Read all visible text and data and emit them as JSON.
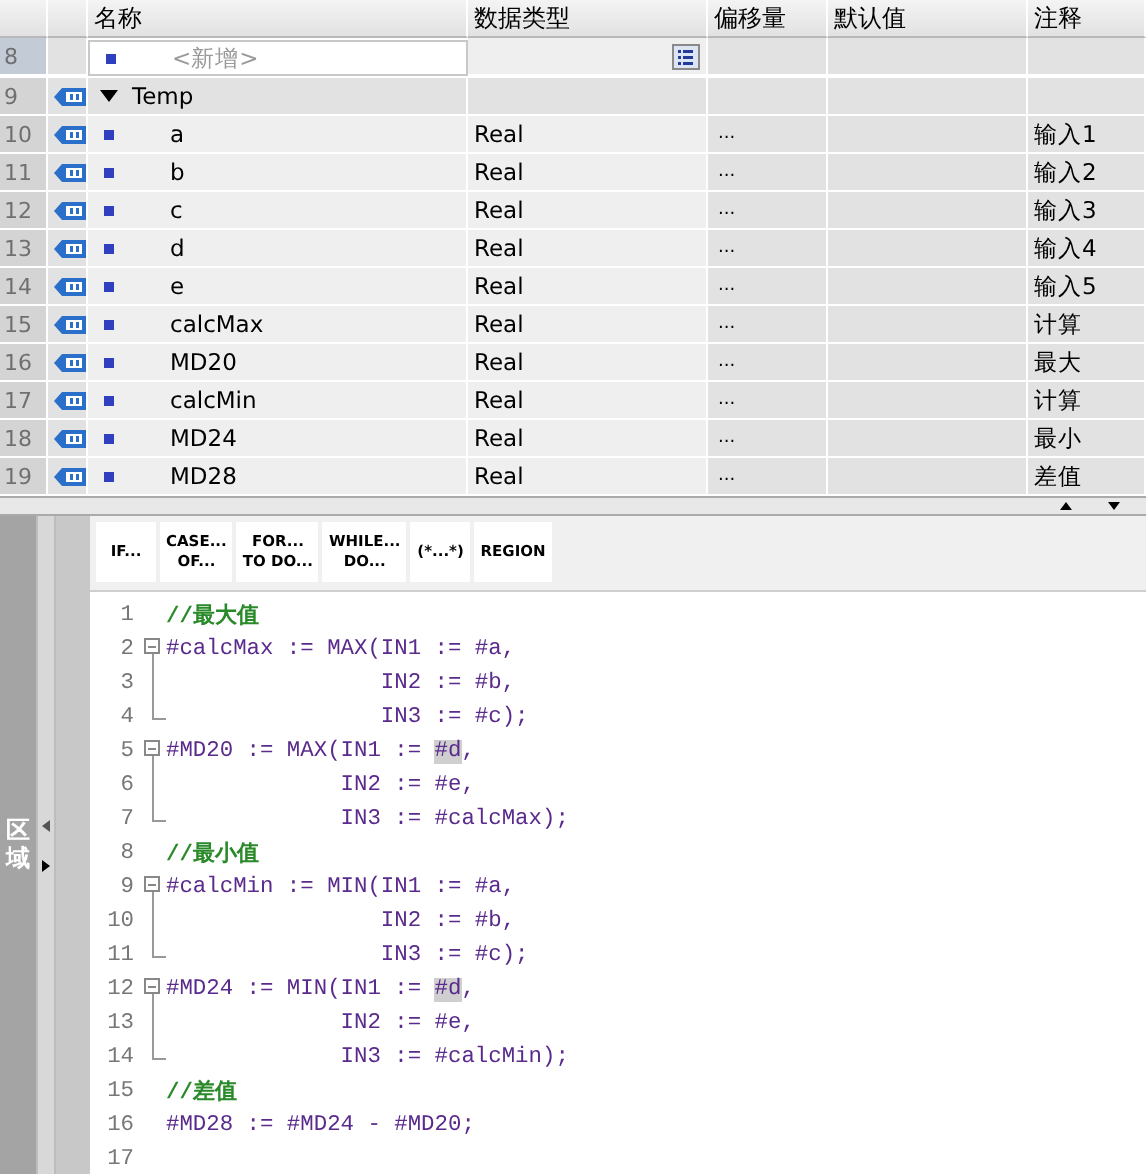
{
  "table": {
    "columns": [
      "名称",
      "数据类型",
      "偏移量",
      "默认值",
      "注释"
    ],
    "rows": [
      {
        "kind": "add",
        "number": "8",
        "selected": true,
        "placeholder": "<新增>"
      },
      {
        "kind": "section",
        "number": "9",
        "selected": false,
        "expanded": true,
        "name": "Temp"
      },
      {
        "kind": "var",
        "number": "10",
        "selected": false,
        "name": "a",
        "type": "Real",
        "offset": "...",
        "comment": "输入1"
      },
      {
        "kind": "var",
        "number": "11",
        "selected": false,
        "name": "b",
        "type": "Real",
        "offset": "...",
        "comment": "输入2"
      },
      {
        "kind": "var",
        "number": "12",
        "selected": false,
        "name": "c",
        "type": "Real",
        "offset": "...",
        "comment": "输入3"
      },
      {
        "kind": "var",
        "number": "13",
        "selected": false,
        "name": "d",
        "type": "Real",
        "offset": "...",
        "comment": "输入4"
      },
      {
        "kind": "var",
        "number": "14",
        "selected": false,
        "name": "e",
        "type": "Real",
        "offset": "...",
        "comment": "输入5"
      },
      {
        "kind": "var",
        "number": "15",
        "selected": false,
        "name": "calcMax",
        "type": "Real",
        "offset": "...",
        "comment": "计算"
      },
      {
        "kind": "var",
        "number": "16",
        "selected": false,
        "name": "MD20",
        "type": "Real",
        "offset": "...",
        "comment": "最大"
      },
      {
        "kind": "var",
        "number": "17",
        "selected": false,
        "name": "calcMin",
        "type": "Real",
        "offset": "...",
        "comment": "计算"
      },
      {
        "kind": "var",
        "number": "18",
        "selected": false,
        "name": "MD24",
        "type": "Real",
        "offset": "...",
        "comment": "最小"
      },
      {
        "kind": "var",
        "number": "19",
        "selected": false,
        "name": "MD28",
        "type": "Real",
        "offset": "...",
        "comment": "差值"
      }
    ]
  },
  "side_panel": {
    "label": "区域"
  },
  "toolbar": [
    [
      "IF..."
    ],
    [
      "CASE...",
      "OF..."
    ],
    [
      "FOR...",
      "TO DO..."
    ],
    [
      "WHILE...",
      "DO..."
    ],
    [
      "(*...*)"
    ],
    [
      "REGION"
    ]
  ],
  "code": [
    {
      "number": "1",
      "kind": "plain",
      "segments": [
        {
          "kind": "comment",
          "text": "//最大值"
        }
      ]
    },
    {
      "number": "2",
      "kind": "opener",
      "segments": [
        {
          "kind": "code",
          "text": "#calcMax := MAX(IN1 := #a,"
        }
      ]
    },
    {
      "number": "3",
      "kind": "inner",
      "segments": [
        {
          "kind": "code",
          "text": "                IN2 := #b,"
        }
      ]
    },
    {
      "number": "4",
      "kind": "closer",
      "segments": [
        {
          "kind": "code",
          "text": "                IN3 := #c);"
        }
      ]
    },
    {
      "number": "5",
      "kind": "opener",
      "segments": [
        {
          "kind": "code",
          "text": "#MD20 := MAX(IN1 := "
        },
        {
          "kind": "marked",
          "text": "#d"
        },
        {
          "kind": "code",
          "text": ","
        }
      ]
    },
    {
      "number": "6",
      "kind": "inner",
      "segments": [
        {
          "kind": "code",
          "text": "             IN2 := #e,"
        }
      ]
    },
    {
      "number": "7",
      "kind": "closer",
      "segments": [
        {
          "kind": "code",
          "text": "             IN3 := #calcMax);"
        }
      ]
    },
    {
      "number": "8",
      "kind": "plain",
      "segments": [
        {
          "kind": "comment",
          "text": "//最小值"
        }
      ]
    },
    {
      "number": "9",
      "kind": "opener",
      "segments": [
        {
          "kind": "code",
          "text": "#calcMin := MIN(IN1 := #a,"
        }
      ]
    },
    {
      "number": "10",
      "kind": "inner",
      "segments": [
        {
          "kind": "code",
          "text": "                IN2 := #b,"
        }
      ]
    },
    {
      "number": "11",
      "kind": "closer",
      "segments": [
        {
          "kind": "code",
          "text": "                IN3 := #c);"
        }
      ]
    },
    {
      "number": "12",
      "kind": "opener",
      "segments": [
        {
          "kind": "code",
          "text": "#MD24 := MIN(IN1 := "
        },
        {
          "kind": "marked",
          "text": "#d"
        },
        {
          "kind": "code",
          "text": ","
        }
      ]
    },
    {
      "number": "13",
      "kind": "inner",
      "segments": [
        {
          "kind": "code",
          "text": "             IN2 := #e,"
        }
      ]
    },
    {
      "number": "14",
      "kind": "closer",
      "segments": [
        {
          "kind": "code",
          "text": "             IN3 := #calcMin);"
        }
      ]
    },
    {
      "number": "15",
      "kind": "plain",
      "segments": [
        {
          "kind": "comment",
          "text": "//差值"
        }
      ]
    },
    {
      "number": "16",
      "kind": "plain",
      "segments": [
        {
          "kind": "code",
          "text": "#MD28 := #MD24 - #MD20;"
        }
      ]
    },
    {
      "number": "17",
      "kind": "plain"
    }
  ]
}
